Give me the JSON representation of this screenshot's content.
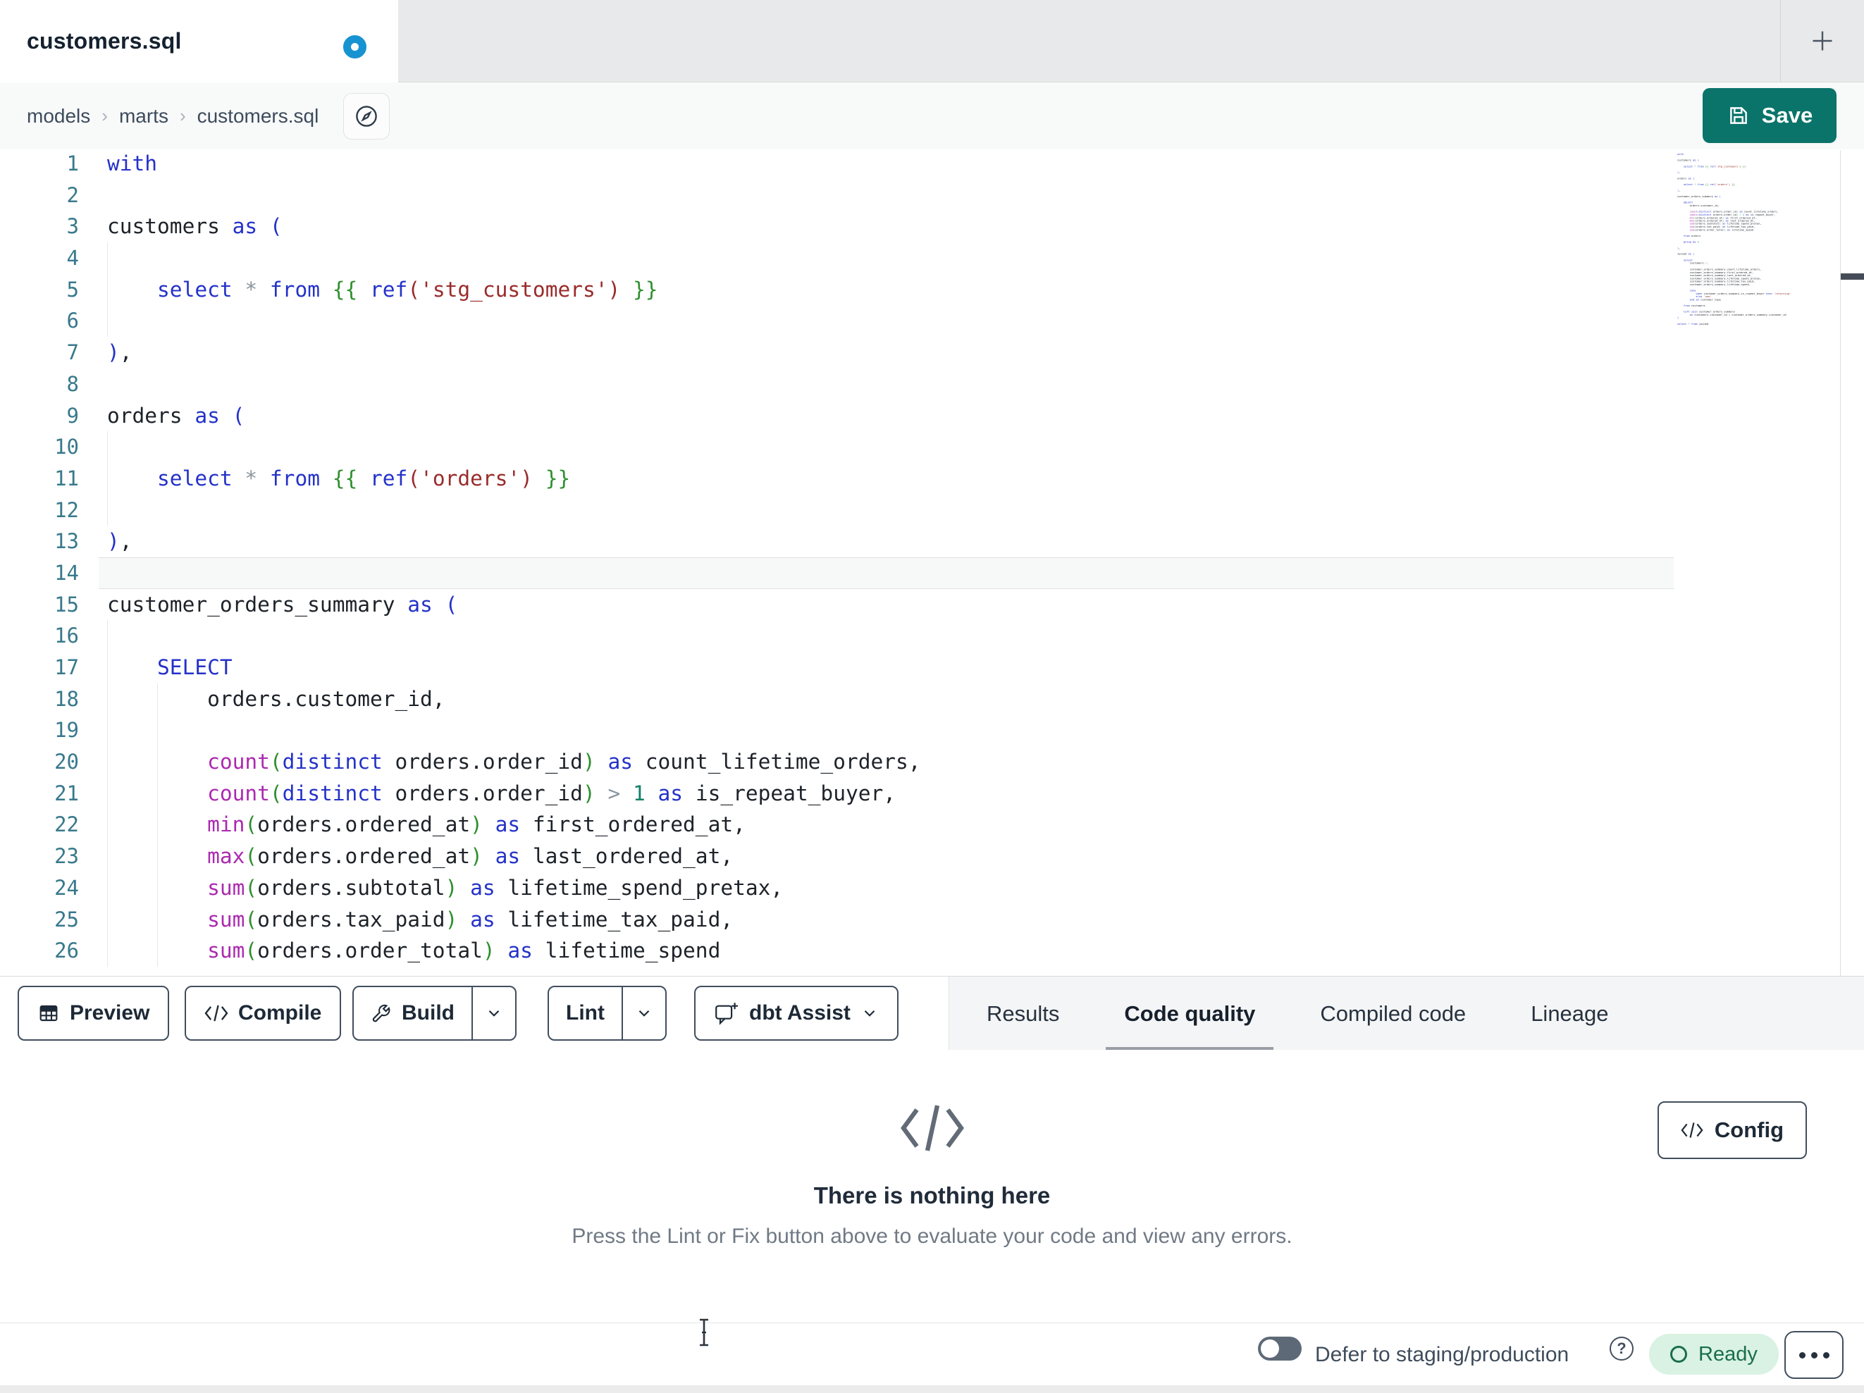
{
  "colors": {
    "kw": "#2432c8",
    "fn": "#ab2ab0",
    "str": "#9a2b2b",
    "jinja": "#2f8f2f",
    "grn": "#2f8f2f",
    "num": "#13806a",
    "op": "#8b959e",
    "txt": "#1d2229",
    "line_no": "#38798c",
    "accent_save": "#0a746b",
    "dot_blue": "#1793d1",
    "ready_bg": "#d9f2e3",
    "ready_fg": "#1a6e4d",
    "guide": "#e6e7e8",
    "active_line_bg": "#f7f8f8",
    "active_line_border": "#e1e1e1"
  },
  "tab_bar": {
    "active_tab": "customers.sql",
    "unsaved_indicator": "blue-dot",
    "new_tab_icon": "plus"
  },
  "header": {
    "breadcrumb": [
      "models",
      "marts",
      "customers.sql"
    ],
    "breadcrumb_sep": "›",
    "save_label": "Save"
  },
  "editor": {
    "active_line": 14,
    "lines": [
      {
        "n": 1,
        "g": [],
        "t": [
          [
            "k",
            "with"
          ]
        ]
      },
      {
        "n": 2,
        "g": [],
        "t": []
      },
      {
        "n": 3,
        "g": [],
        "t": [
          [
            "t",
            "customers "
          ],
          [
            "k",
            "as"
          ],
          [
            "t",
            " "
          ],
          [
            "k",
            "("
          ]
        ]
      },
      {
        "n": 4,
        "g": [
          0
        ],
        "t": []
      },
      {
        "n": 5,
        "g": [
          0
        ],
        "t": [
          [
            "t",
            "    "
          ],
          [
            "k",
            "select"
          ],
          [
            "t",
            " "
          ],
          [
            "o",
            "*"
          ],
          [
            "t",
            " "
          ],
          [
            "k",
            "from"
          ],
          [
            "t",
            " "
          ],
          [
            "j",
            "{{"
          ],
          [
            "t",
            " "
          ],
          [
            "k",
            "ref"
          ],
          [
            "s",
            "('stg_customers')"
          ],
          [
            "t",
            " "
          ],
          [
            "j",
            "}}"
          ]
        ]
      },
      {
        "n": 6,
        "g": [
          0
        ],
        "t": []
      },
      {
        "n": 7,
        "g": [],
        "t": [
          [
            "k",
            ")"
          ],
          [
            "t",
            ","
          ]
        ]
      },
      {
        "n": 8,
        "g": [],
        "t": []
      },
      {
        "n": 9,
        "g": [],
        "t": [
          [
            "t",
            "orders "
          ],
          [
            "k",
            "as"
          ],
          [
            "t",
            " "
          ],
          [
            "k",
            "("
          ]
        ]
      },
      {
        "n": 10,
        "g": [
          0
        ],
        "t": []
      },
      {
        "n": 11,
        "g": [
          0
        ],
        "t": [
          [
            "t",
            "    "
          ],
          [
            "k",
            "select"
          ],
          [
            "t",
            " "
          ],
          [
            "o",
            "*"
          ],
          [
            "t",
            " "
          ],
          [
            "k",
            "from"
          ],
          [
            "t",
            " "
          ],
          [
            "j",
            "{{"
          ],
          [
            "t",
            " "
          ],
          [
            "k",
            "ref"
          ],
          [
            "s",
            "('orders')"
          ],
          [
            "t",
            " "
          ],
          [
            "j",
            "}}"
          ]
        ]
      },
      {
        "n": 12,
        "g": [
          0
        ],
        "t": []
      },
      {
        "n": 13,
        "g": [],
        "t": [
          [
            "k",
            ")"
          ],
          [
            "t",
            ","
          ]
        ]
      },
      {
        "n": 14,
        "g": [],
        "t": []
      },
      {
        "n": 15,
        "g": [],
        "t": [
          [
            "t",
            "customer_orders_summary "
          ],
          [
            "k",
            "as"
          ],
          [
            "t",
            " "
          ],
          [
            "k",
            "("
          ]
        ]
      },
      {
        "n": 16,
        "g": [
          0
        ],
        "t": []
      },
      {
        "n": 17,
        "g": [
          0
        ],
        "t": [
          [
            "t",
            "    "
          ],
          [
            "k",
            "SELECT"
          ]
        ]
      },
      {
        "n": 18,
        "g": [
          0,
          1
        ],
        "t": [
          [
            "t",
            "        orders.customer_id,"
          ]
        ]
      },
      {
        "n": 19,
        "g": [
          0,
          1
        ],
        "t": []
      },
      {
        "n": 20,
        "g": [
          0,
          1
        ],
        "t": [
          [
            "t",
            "        "
          ],
          [
            "f",
            "count"
          ],
          [
            "g",
            "("
          ],
          [
            "k",
            "distinct"
          ],
          [
            "t",
            " orders.order_id"
          ],
          [
            "g",
            ")"
          ],
          [
            "t",
            " "
          ],
          [
            "k",
            "as"
          ],
          [
            "t",
            " count_lifetime_orders,"
          ]
        ]
      },
      {
        "n": 21,
        "g": [
          0,
          1
        ],
        "t": [
          [
            "t",
            "        "
          ],
          [
            "f",
            "count"
          ],
          [
            "g",
            "("
          ],
          [
            "k",
            "distinct"
          ],
          [
            "t",
            " orders.order_id"
          ],
          [
            "g",
            ")"
          ],
          [
            "t",
            " "
          ],
          [
            "o",
            ">"
          ],
          [
            "t",
            " "
          ],
          [
            "n",
            "1"
          ],
          [
            "t",
            " "
          ],
          [
            "k",
            "as"
          ],
          [
            "t",
            " is_repeat_buyer,"
          ]
        ]
      },
      {
        "n": 22,
        "g": [
          0,
          1
        ],
        "t": [
          [
            "t",
            "        "
          ],
          [
            "f",
            "min"
          ],
          [
            "g",
            "("
          ],
          [
            "t",
            "orders.ordered_at"
          ],
          [
            "g",
            ")"
          ],
          [
            "t",
            " "
          ],
          [
            "k",
            "as"
          ],
          [
            "t",
            " first_ordered_at,"
          ]
        ]
      },
      {
        "n": 23,
        "g": [
          0,
          1
        ],
        "t": [
          [
            "t",
            "        "
          ],
          [
            "f",
            "max"
          ],
          [
            "g",
            "("
          ],
          [
            "t",
            "orders.ordered_at"
          ],
          [
            "g",
            ")"
          ],
          [
            "t",
            " "
          ],
          [
            "k",
            "as"
          ],
          [
            "t",
            " last_ordered_at,"
          ]
        ]
      },
      {
        "n": 24,
        "g": [
          0,
          1
        ],
        "t": [
          [
            "t",
            "        "
          ],
          [
            "f",
            "sum"
          ],
          [
            "g",
            "("
          ],
          [
            "t",
            "orders.subtotal"
          ],
          [
            "g",
            ")"
          ],
          [
            "t",
            " "
          ],
          [
            "k",
            "as"
          ],
          [
            "t",
            " lifetime_spend_pretax,"
          ]
        ]
      },
      {
        "n": 25,
        "g": [
          0,
          1
        ],
        "t": [
          [
            "t",
            "        "
          ],
          [
            "f",
            "sum"
          ],
          [
            "g",
            "("
          ],
          [
            "t",
            "orders.tax_paid"
          ],
          [
            "g",
            ")"
          ],
          [
            "t",
            " "
          ],
          [
            "k",
            "as"
          ],
          [
            "t",
            " lifetime_tax_paid,"
          ]
        ]
      },
      {
        "n": 26,
        "g": [
          0,
          1
        ],
        "t": [
          [
            "t",
            "        "
          ],
          [
            "f",
            "sum"
          ],
          [
            "g",
            "("
          ],
          [
            "t",
            "orders.order_total"
          ],
          [
            "g",
            ")"
          ],
          [
            "t",
            " "
          ],
          [
            "k",
            "as"
          ],
          [
            "t",
            " lifetime_spend"
          ]
        ]
      }
    ]
  },
  "file_lines": [
    [
      [
        "k",
        "with"
      ]
    ],
    [],
    [
      [
        "t",
        "customers "
      ],
      [
        "k",
        "as"
      ],
      [
        "t",
        " "
      ],
      [
        "k",
        "("
      ]
    ],
    [],
    [
      [
        "t",
        "    "
      ],
      [
        "k",
        "select"
      ],
      [
        "t",
        " "
      ],
      [
        "o",
        "*"
      ],
      [
        "t",
        " "
      ],
      [
        "k",
        "from"
      ],
      [
        "t",
        " "
      ],
      [
        "j",
        "{{"
      ],
      [
        "t",
        " "
      ],
      [
        "k",
        "ref"
      ],
      [
        "s",
        "('stg_customers')"
      ],
      [
        "t",
        " "
      ],
      [
        "j",
        "}}"
      ]
    ],
    [],
    [
      [
        "k",
        ")"
      ],
      [
        "t",
        ","
      ]
    ],
    [],
    [
      [
        "t",
        "orders "
      ],
      [
        "k",
        "as"
      ],
      [
        "t",
        " "
      ],
      [
        "k",
        "("
      ]
    ],
    [],
    [
      [
        "t",
        "    "
      ],
      [
        "k",
        "select"
      ],
      [
        "t",
        " "
      ],
      [
        "o",
        "*"
      ],
      [
        "t",
        " "
      ],
      [
        "k",
        "from"
      ],
      [
        "t",
        " "
      ],
      [
        "j",
        "{{"
      ],
      [
        "t",
        " "
      ],
      [
        "k",
        "ref"
      ],
      [
        "s",
        "('orders')"
      ],
      [
        "t",
        " "
      ],
      [
        "j",
        "}}"
      ]
    ],
    [],
    [
      [
        "k",
        ")"
      ],
      [
        "t",
        ","
      ]
    ],
    [],
    [
      [
        "t",
        "customer_orders_summary "
      ],
      [
        "k",
        "as"
      ],
      [
        "t",
        " "
      ],
      [
        "k",
        "("
      ]
    ],
    [],
    [
      [
        "t",
        "    "
      ],
      [
        "k",
        "SELECT"
      ]
    ],
    [
      [
        "t",
        "        orders.customer_id,"
      ]
    ],
    [],
    [
      [
        "t",
        "        "
      ],
      [
        "f",
        "count"
      ],
      [
        "g",
        "("
      ],
      [
        "k",
        "distinct"
      ],
      [
        "t",
        " orders.order_id"
      ],
      [
        "g",
        ")"
      ],
      [
        "t",
        " "
      ],
      [
        "k",
        "as"
      ],
      [
        "t",
        " count_lifetime_orders,"
      ]
    ],
    [
      [
        "t",
        "        "
      ],
      [
        "f",
        "count"
      ],
      [
        "g",
        "("
      ],
      [
        "k",
        "distinct"
      ],
      [
        "t",
        " orders.order_id"
      ],
      [
        "g",
        ")"
      ],
      [
        "t",
        " "
      ],
      [
        "o",
        ">"
      ],
      [
        "t",
        " "
      ],
      [
        "n",
        "1"
      ],
      [
        "t",
        " "
      ],
      [
        "k",
        "as"
      ],
      [
        "t",
        " is_repeat_buyer,"
      ]
    ],
    [
      [
        "t",
        "        "
      ],
      [
        "f",
        "min"
      ],
      [
        "g",
        "("
      ],
      [
        "t",
        "orders.ordered_at"
      ],
      [
        "g",
        ")"
      ],
      [
        "t",
        " "
      ],
      [
        "k",
        "as"
      ],
      [
        "t",
        " first_ordered_at,"
      ]
    ],
    [
      [
        "t",
        "        "
      ],
      [
        "f",
        "max"
      ],
      [
        "g",
        "("
      ],
      [
        "t",
        "orders.ordered_at"
      ],
      [
        "g",
        ")"
      ],
      [
        "t",
        " "
      ],
      [
        "k",
        "as"
      ],
      [
        "t",
        " last_ordered_at,"
      ]
    ],
    [
      [
        "t",
        "        "
      ],
      [
        "f",
        "sum"
      ],
      [
        "g",
        "("
      ],
      [
        "t",
        "orders.subtotal"
      ],
      [
        "g",
        ")"
      ],
      [
        "t",
        " "
      ],
      [
        "k",
        "as"
      ],
      [
        "t",
        " lifetime_spend_pretax,"
      ]
    ],
    [
      [
        "t",
        "        "
      ],
      [
        "f",
        "sum"
      ],
      [
        "g",
        "("
      ],
      [
        "t",
        "orders.tax_paid"
      ],
      [
        "g",
        ")"
      ],
      [
        "t",
        " "
      ],
      [
        "k",
        "as"
      ],
      [
        "t",
        " lifetime_tax_paid,"
      ]
    ],
    [
      [
        "t",
        "        "
      ],
      [
        "f",
        "sum"
      ],
      [
        "g",
        "("
      ],
      [
        "t",
        "orders.order_total"
      ],
      [
        "g",
        ")"
      ],
      [
        "t",
        " "
      ],
      [
        "k",
        "as"
      ],
      [
        "t",
        " lifetime_spend"
      ]
    ],
    [],
    [
      [
        "t",
        "    "
      ],
      [
        "k",
        "from"
      ],
      [
        "t",
        " orders"
      ]
    ],
    [],
    [
      [
        "t",
        "    "
      ],
      [
        "k",
        "group by"
      ],
      [
        "t",
        " "
      ],
      [
        "n",
        "1"
      ]
    ],
    [],
    [
      [
        "k",
        ")"
      ],
      [
        "t",
        ","
      ]
    ],
    [],
    [
      [
        "t",
        "joined "
      ],
      [
        "k",
        "as"
      ],
      [
        "t",
        " "
      ],
      [
        "k",
        "("
      ]
    ],
    [],
    [
      [
        "t",
        "    "
      ],
      [
        "k",
        "select"
      ]
    ],
    [
      [
        "t",
        "        customers."
      ],
      [
        "o",
        "*"
      ],
      [
        "t",
        ","
      ]
    ],
    [],
    [
      [
        "t",
        "        customer_orders_summary.count_lifetime_orders,"
      ]
    ],
    [
      [
        "t",
        "        customer_orders_summary.first_ordered_at,"
      ]
    ],
    [
      [
        "t",
        "        customer_orders_summary.last_ordered_at,"
      ]
    ],
    [
      [
        "t",
        "        customer_orders_summary.lifetime_spend_pretax,"
      ]
    ],
    [
      [
        "t",
        "        customer_orders_summary.lifetime_tax_paid,"
      ]
    ],
    [
      [
        "t",
        "        customer_orders_summary.lifetime_spend,"
      ]
    ],
    [],
    [
      [
        "t",
        "        "
      ],
      [
        "k",
        "case"
      ]
    ],
    [
      [
        "t",
        "            "
      ],
      [
        "k",
        "when"
      ],
      [
        "t",
        " customer_orders_summary.is_repeat_buyer "
      ],
      [
        "k",
        "then"
      ],
      [
        "t",
        " "
      ],
      [
        "s",
        "'returning'"
      ]
    ],
    [
      [
        "t",
        "            "
      ],
      [
        "k",
        "else"
      ],
      [
        "t",
        " "
      ],
      [
        "s",
        "'new'"
      ]
    ],
    [
      [
        "t",
        "        "
      ],
      [
        "k",
        "end"
      ],
      [
        "t",
        " "
      ],
      [
        "k",
        "as"
      ],
      [
        "t",
        " customer_type"
      ]
    ],
    [],
    [
      [
        "t",
        "    "
      ],
      [
        "k",
        "from"
      ],
      [
        "t",
        " customers"
      ]
    ],
    [],
    [
      [
        "t",
        "    "
      ],
      [
        "k",
        "left join"
      ],
      [
        "t",
        " customer_orders_summary"
      ]
    ],
    [
      [
        "t",
        "        "
      ],
      [
        "k",
        "on"
      ],
      [
        "t",
        " customers.customer_id = customer_orders_summary.customer_id"
      ]
    ],
    [
      [
        "k",
        ")"
      ]
    ],
    [],
    [
      [
        "k",
        "select"
      ],
      [
        "t",
        " "
      ],
      [
        "o",
        "*"
      ],
      [
        "t",
        " "
      ],
      [
        "k",
        "from"
      ],
      [
        "t",
        " joined"
      ]
    ]
  ],
  "toolbar": {
    "preview_label": "Preview",
    "compile_label": "Compile",
    "build_label": "Build",
    "lint_label": "Lint",
    "assist_label": "dbt Assist"
  },
  "panel": {
    "tabs": [
      {
        "label": "Results",
        "active": false
      },
      {
        "label": "Code quality",
        "active": true
      },
      {
        "label": "Compiled code",
        "active": false
      },
      {
        "label": "Lineage",
        "active": false
      }
    ]
  },
  "empty_state": {
    "title": "There is nothing here",
    "subtitle": "Press the Lint or Fix button above to evaluate your code and view any errors.",
    "config_label": "Config"
  },
  "status_bar": {
    "defer_label": "Defer to staging/production",
    "ready_label": "Ready",
    "toggle_state": "off"
  }
}
